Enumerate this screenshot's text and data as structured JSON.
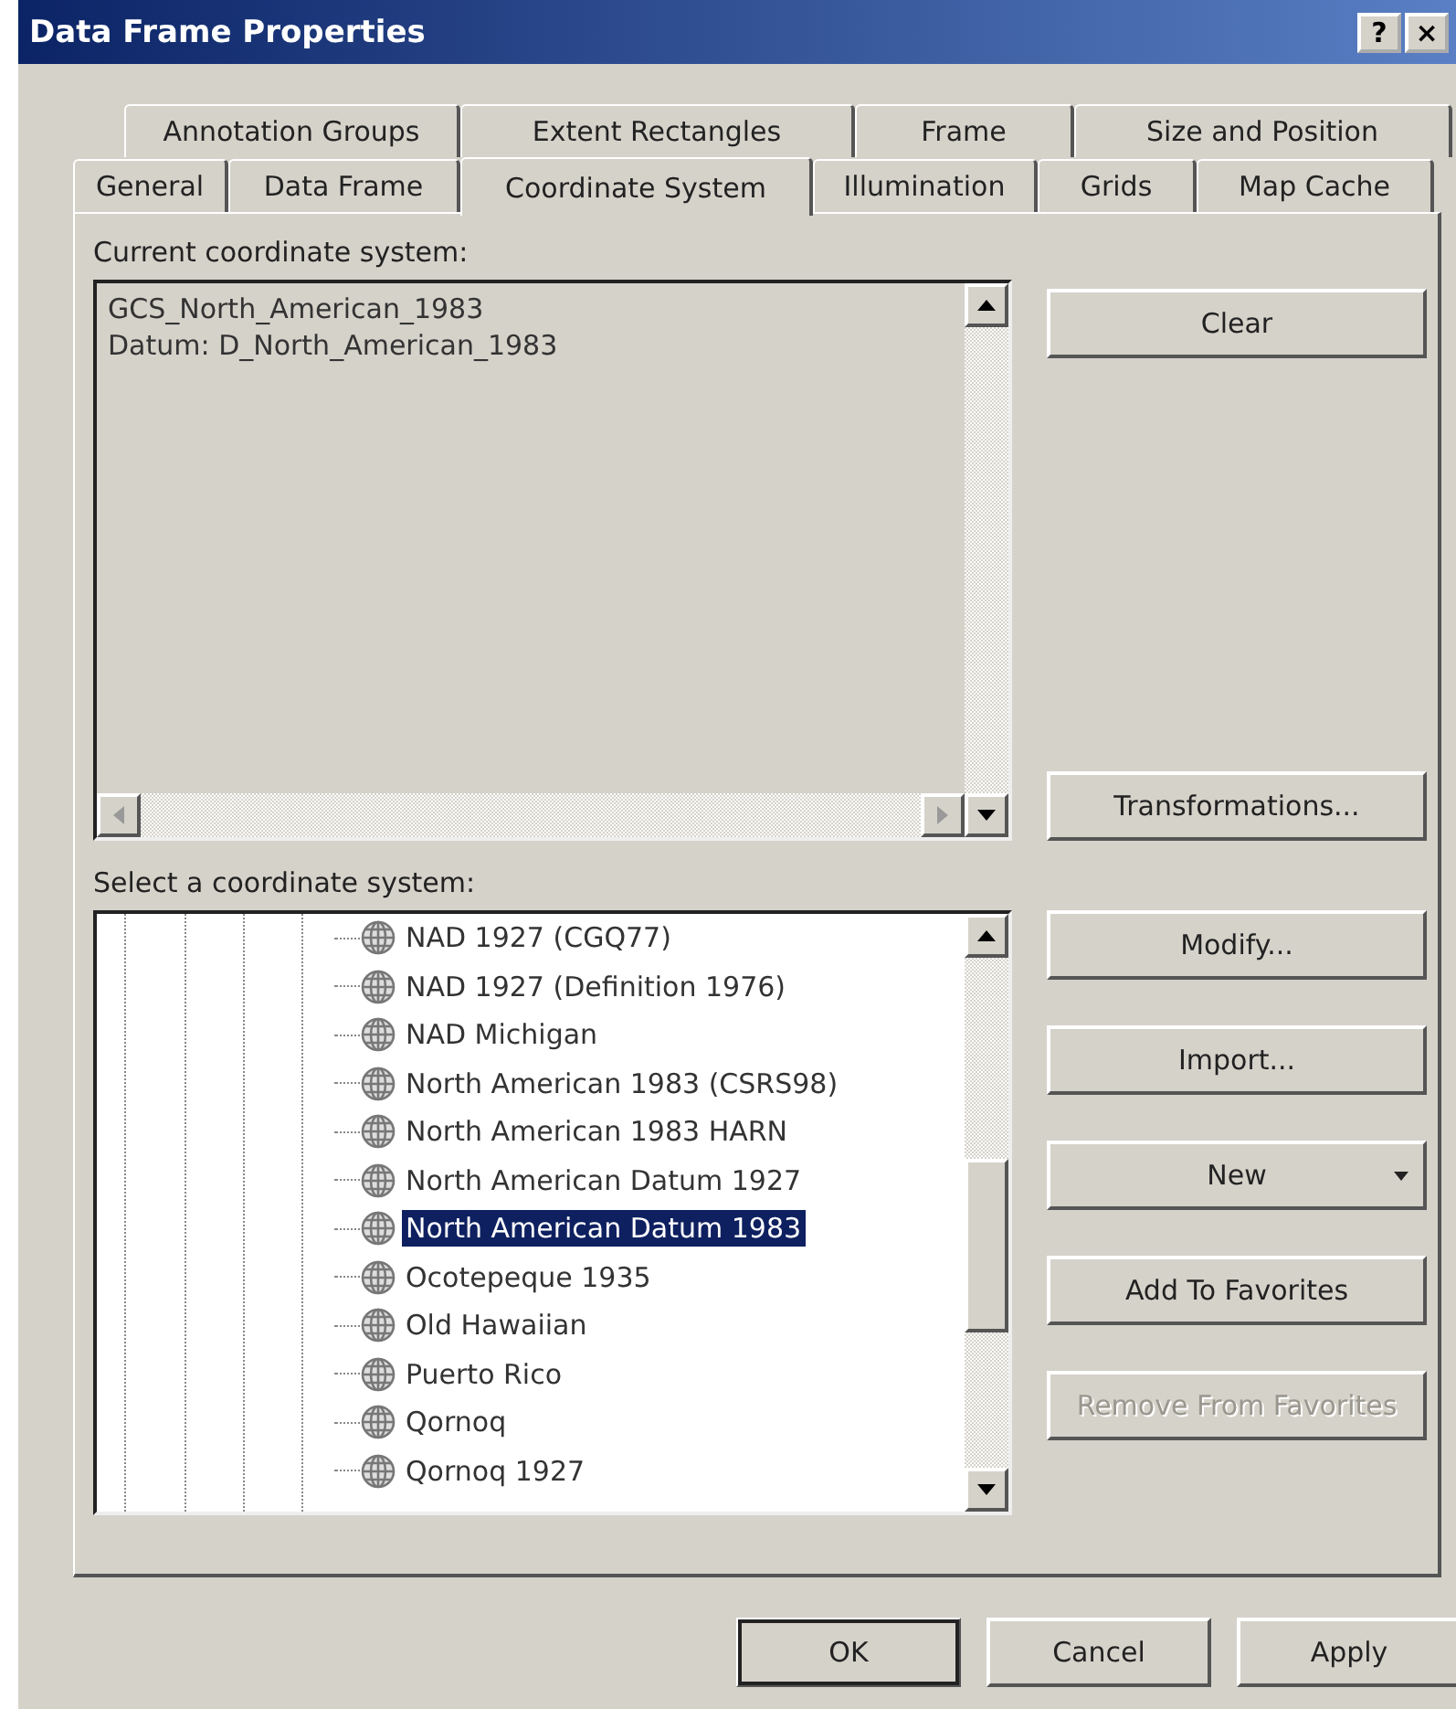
{
  "window": {
    "title": "Data Frame Properties",
    "title_buttons": [
      "?",
      "×"
    ]
  },
  "tab_rows": [
    [
      {
        "label": "Annotation Groups",
        "selected": false
      },
      {
        "label": "Extent Rectangles",
        "selected": false
      },
      {
        "label": "Frame",
        "selected": false
      },
      {
        "label": "Size and Position",
        "selected": false
      }
    ],
    [
      {
        "label": "General",
        "selected": false
      },
      {
        "label": "Data Frame",
        "selected": false
      },
      {
        "label": "Coordinate System",
        "selected": true
      },
      {
        "label": "Illumination",
        "selected": false
      },
      {
        "label": "Grids",
        "selected": false
      },
      {
        "label": "Map Cache",
        "selected": false
      }
    ]
  ],
  "current": {
    "label": "Current coordinate system:",
    "lines": [
      "GCS_North_American_1983",
      "Datum: D_North_American_1983"
    ],
    "side_buttons": [
      {
        "label": "Clear",
        "disabled": false
      },
      {
        "label": "Transformations...",
        "disabled": false
      }
    ]
  },
  "select": {
    "label": "Select a coordinate system:",
    "items": [
      {
        "label": "NAD 1927 (CGQ77)",
        "selected": false
      },
      {
        "label": "NAD 1927 (Definition 1976)",
        "selected": false
      },
      {
        "label": "NAD Michigan",
        "selected": false
      },
      {
        "label": "North American 1983 (CSRS98)",
        "selected": false
      },
      {
        "label": "North American 1983 HARN",
        "selected": false
      },
      {
        "label": "North American Datum 1927",
        "selected": false
      },
      {
        "label": "North American Datum 1983",
        "selected": true
      },
      {
        "label": "Ocotepeque 1935",
        "selected": false
      },
      {
        "label": "Old Hawaiian",
        "selected": false
      },
      {
        "label": "Puerto Rico",
        "selected": false
      },
      {
        "label": "Qornoq",
        "selected": false
      },
      {
        "label": "Qornoq 1927",
        "selected": false
      }
    ],
    "side_buttons": [
      {
        "label": "Modify...",
        "kind": "plain",
        "disabled": false
      },
      {
        "label": "Import...",
        "kind": "plain",
        "disabled": false
      },
      {
        "label": "New",
        "kind": "menu",
        "disabled": false
      },
      {
        "label": "Add To Favorites",
        "kind": "plain",
        "disabled": false
      },
      {
        "label": "Remove From Favorites",
        "kind": "plain",
        "disabled": true
      }
    ]
  },
  "buttons": [
    {
      "label": "OK",
      "default": true
    },
    {
      "label": "Cancel",
      "default": false
    },
    {
      "label": "Apply",
      "default": false
    }
  ]
}
